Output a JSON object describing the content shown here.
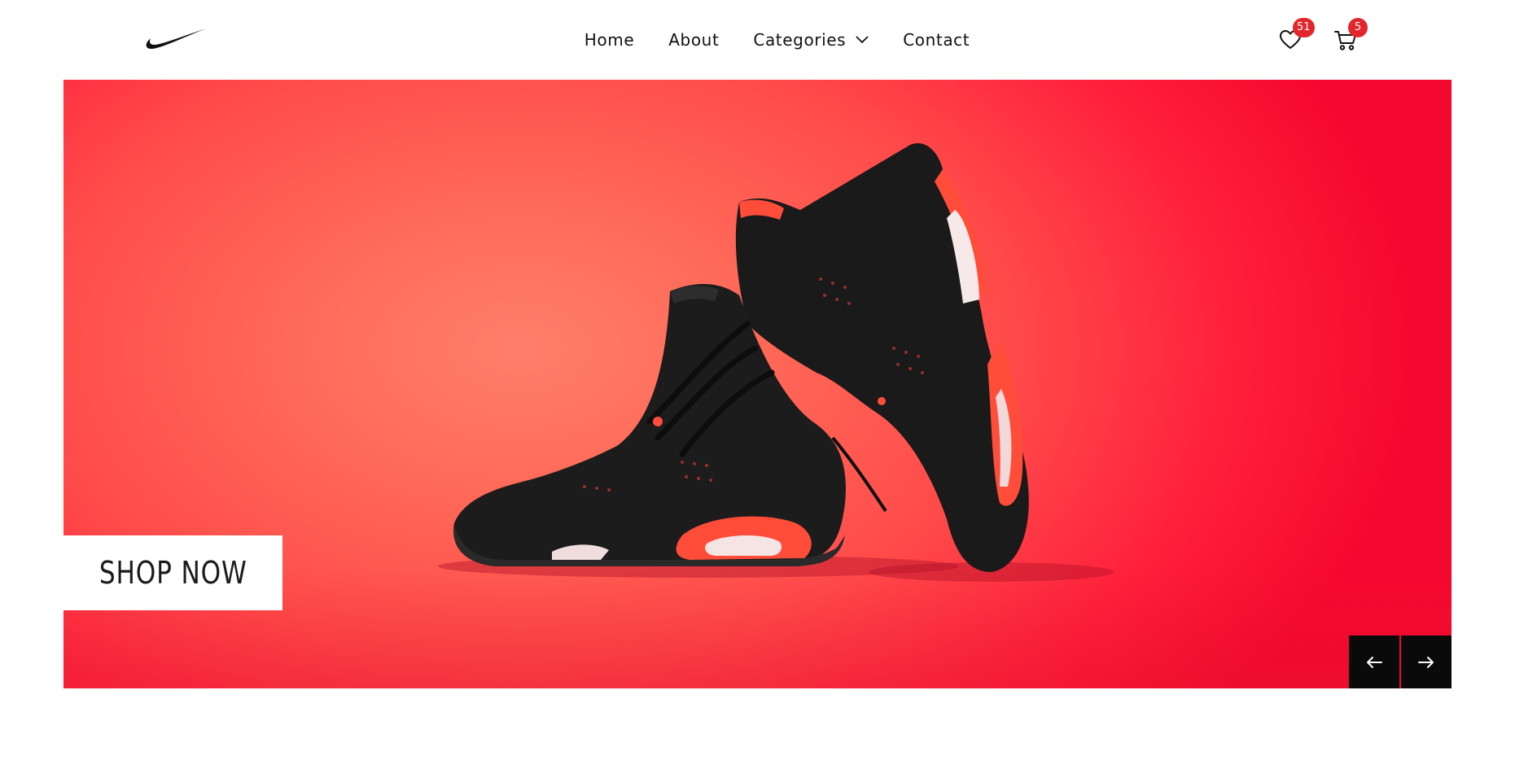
{
  "brand": {
    "logo_icon": "swoosh-logo-icon"
  },
  "nav": {
    "items": [
      {
        "label": "Home"
      },
      {
        "label": "About"
      },
      {
        "label": "Categories",
        "icon": "chevron-down-icon"
      },
      {
        "label": "Contact"
      }
    ]
  },
  "header_icons": {
    "wishlist": {
      "icon": "heart-icon",
      "badge": "51"
    },
    "cart": {
      "icon": "cart-icon",
      "badge": "5"
    },
    "badge_color": "#e3262b"
  },
  "hero": {
    "image": "black-and-red-sneakers-photo",
    "background_color": "#ff4a4a",
    "cta_label": "SHOP NOW",
    "prev_icon": "arrow-left-icon",
    "next_icon": "arrow-right-icon"
  }
}
